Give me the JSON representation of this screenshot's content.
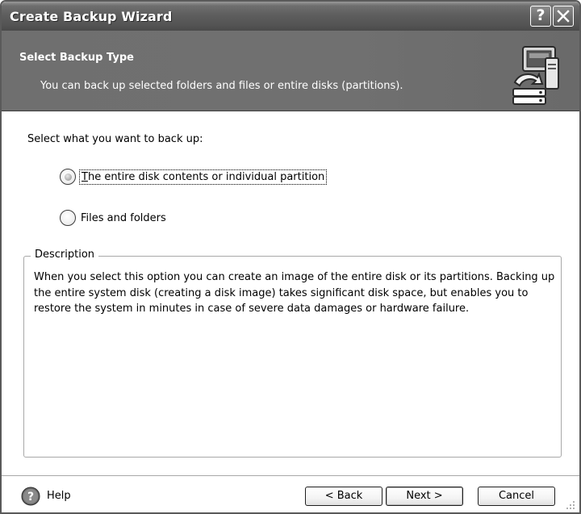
{
  "window": {
    "title": "Create Backup Wizard",
    "help_button": "?",
    "close_button": "✕"
  },
  "header": {
    "title": "Select Backup Type",
    "subtitle": "You can back up selected folders and files or entire disks (partitions)."
  },
  "main": {
    "prompt": "Select what you want to back up:",
    "options": [
      {
        "label": "The entire disk contents or individual partition",
        "selected": true
      },
      {
        "label": "Files and folders",
        "selected": false
      }
    ]
  },
  "description": {
    "title": "Description",
    "text": "When you select this option you can create an image of the entire disk or its partitions. Backing up the entire system disk (creating a disk image) takes significant disk space, but enables you to restore the system in minutes in case of severe data damages or hardware failure."
  },
  "footer": {
    "help_label": "Help",
    "back_label": "< Back",
    "next_label": "Next >",
    "cancel_label": "Cancel"
  }
}
